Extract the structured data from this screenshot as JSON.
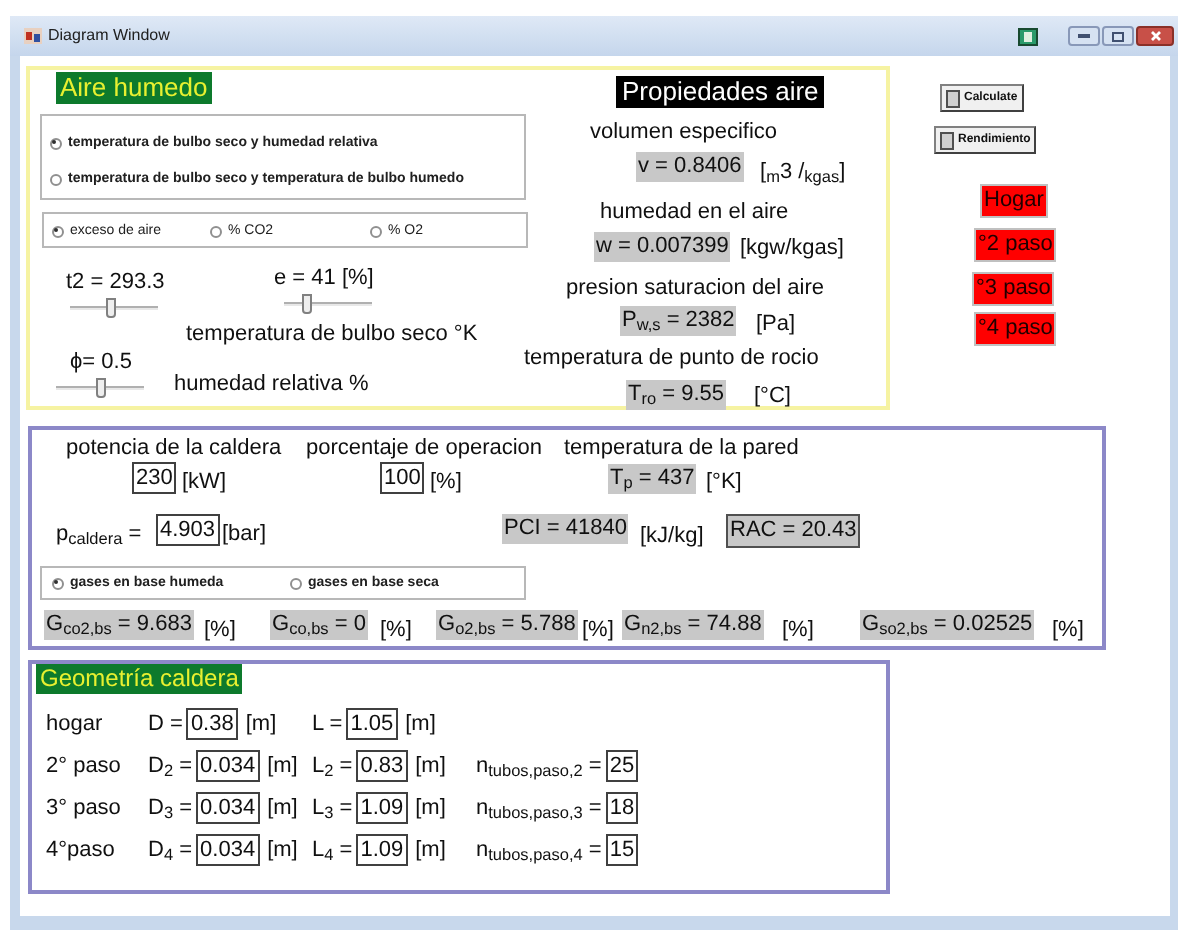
{
  "window": {
    "title": "Diagram Window"
  },
  "aire_humedo": {
    "heading": "Aire humedo",
    "input_mode": [
      {
        "label": "temperatura de bulbo seco y humedad relativa",
        "selected": true
      },
      {
        "label": "temperatura de bulbo seco y temperatura de bulbo humedo",
        "selected": false
      }
    ],
    "combustion_input": [
      {
        "label": "exceso de aire",
        "selected": true
      },
      {
        "label": "% CO2",
        "selected": false
      },
      {
        "label": "% O2",
        "selected": false
      }
    ],
    "sliders": [
      {
        "label": "t2 = 293.3",
        "level": 0.47
      },
      {
        "label": "e = 41  [%]",
        "level": 0.23
      },
      {
        "label": "ϕ= 0.5",
        "level": 0.52
      }
    ],
    "captions": [
      "temperatura de bulbo seco °K",
      "humedad relativa %"
    ]
  },
  "propiedades_aire": {
    "heading": "Propiedades aire",
    "quantities": [
      {
        "label": "volumen especifico",
        "value": "v = 0.8406",
        "unit": "[$_{m}$3 /$_{kgas}$]"
      },
      {
        "label": "humedad en el aire",
        "value": "w = 0.007399",
        "unit": "[kgw/kgas]"
      },
      {
        "label": "presion saturacion del aire",
        "value": "P$_{w,s}$ = 2382",
        "unit": "[Pa]"
      },
      {
        "label": "temperatura de punto de rocio",
        "value": "T$_{ro}$ = 9.55",
        "unit": "[°C]"
      }
    ]
  },
  "buttons": [
    "Calculate",
    "Rendimiento"
  ],
  "section_tags": [
    "Hogar",
    "°2 paso",
    "°3 paso",
    "°4 paso"
  ],
  "caldera": {
    "inputs": [
      {
        "label": "potencia de la caldera",
        "value": "230",
        "unit": "[kW]"
      },
      {
        "label": "porcentaje de operacion",
        "value": "100",
        "unit": "[%]"
      }
    ],
    "wall_temperature": {
      "label": "temperatura de la pared",
      "value": "T$_{p}$ = 437",
      "unit": "[°K]"
    },
    "pressure": {
      "label": "p$_{caldera}$ =",
      "value": "4.903",
      "unit": "[bar]"
    },
    "pci": {
      "value": "PCI = 41840",
      "unit": "[kJ/kg]"
    },
    "rac": "RAC = 20.43",
    "gas_basis": [
      {
        "label": "gases en base humeda",
        "selected": true
      },
      {
        "label": "gases en base seca",
        "selected": false
      }
    ],
    "gases": [
      {
        "value": "G$_{co2,bs}$ = 9.683",
        "unit": "[%]"
      },
      {
        "value": "G$_{co,bs}$ = 0",
        "unit": "[%]"
      },
      {
        "value": "G$_{o2,bs}$ = 5.788",
        "unit": "[%]"
      },
      {
        "value": "G$_{n2,bs}$ = 74.88",
        "unit": "[%]"
      },
      {
        "value": "G$_{so2,bs}$ = 0.02525",
        "unit": "[%]"
      }
    ]
  },
  "geometria_caldera": {
    "heading": "Geometría caldera",
    "rows": [
      {
        "label": "hogar",
        "diameter": {
          "label": "D =",
          "value": "0.38",
          "unit": "[m]"
        },
        "length": {
          "label": "L =",
          "value": "1.05",
          "unit": "[m]"
        }
      },
      {
        "label": "2° paso",
        "diameter": {
          "label": "D$_{2}$ =",
          "value": "0.034",
          "unit": "[m]"
        },
        "length": {
          "label": "L$_{2}$ =",
          "value": "0.83",
          "unit": "[m]"
        },
        "tubes": {
          "label": "n$_{tubos,paso,2}$ =",
          "value": "25"
        }
      },
      {
        "label": "3° paso",
        "diameter": {
          "label": "D$_{3}$ =",
          "value": "0.034",
          "unit": "[m]"
        },
        "length": {
          "label": "L$_{3}$ =",
          "value": "1.09",
          "unit": "[m]"
        },
        "tubes": {
          "label": "n$_{tubos,paso,3}$ =",
          "value": "18"
        }
      },
      {
        "label": "4°paso",
        "diameter": {
          "label": "D$_{4}$ =",
          "value": "0.034",
          "unit": "[m]"
        },
        "length": {
          "label": "L$_{4}$ =",
          "value": "1.09",
          "unit": "[m]"
        },
        "tubes": {
          "label": "n$_{tubos,paso,4}$ =",
          "value": "15"
        }
      }
    ]
  }
}
